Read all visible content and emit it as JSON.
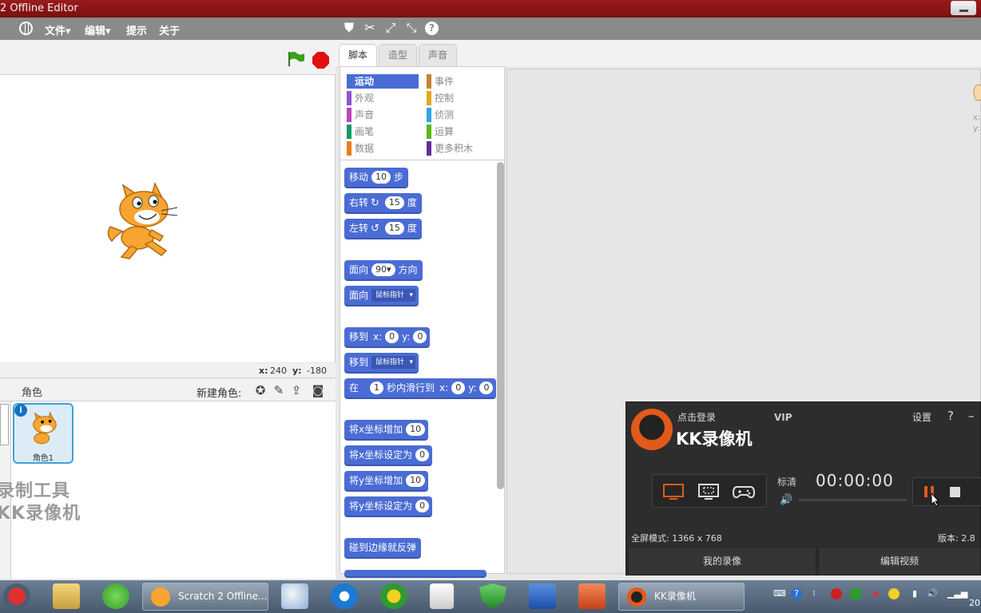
{
  "window": {
    "title": "2 Offline Editor"
  },
  "menu": {
    "file": "文件▾",
    "edit": "编辑▾",
    "tips": "提示",
    "about": "关于",
    "help_icon": "?"
  },
  "stage": {
    "x_label": "x:",
    "x_value": "240",
    "y_label": "y:",
    "y_value": "-180"
  },
  "sprites": {
    "header": "角色",
    "new_sprite": "新建角色:",
    "items": [
      {
        "name": "角色1"
      }
    ],
    "info_glyph": "i"
  },
  "watermark": {
    "line1": "录制工具",
    "line2": "KK录像机"
  },
  "tabs": [
    "脚本",
    "造型",
    "声音"
  ],
  "categories": [
    {
      "label": "运动",
      "color": "#4a6cd4",
      "selected": true
    },
    {
      "label": "外观",
      "color": "#8a55d7"
    },
    {
      "label": "声音",
      "color": "#bb42c3"
    },
    {
      "label": "画笔",
      "color": "#0e9a6c"
    },
    {
      "label": "数据",
      "color": "#ee7d16"
    },
    {
      "label": "事件",
      "color": "#c88330"
    },
    {
      "label": "控制",
      "color": "#e1a91a"
    },
    {
      "label": "侦测",
      "color": "#2ca5e2"
    },
    {
      "label": "运算",
      "color": "#5cb712"
    },
    {
      "label": "更多积木",
      "color": "#632d99"
    }
  ],
  "blocks": {
    "move": {
      "a": "移动",
      "n": "10",
      "b": "步"
    },
    "turn_right": {
      "a": "右转",
      "n": "15",
      "b": "度"
    },
    "turn_left": {
      "a": "左转",
      "n": "15",
      "b": "度"
    },
    "point_dir": {
      "a": "面向",
      "n": "90▾",
      "b": "方向"
    },
    "point_towards": {
      "a": "面向",
      "dd": "鼠标指针"
    },
    "goto_xy": {
      "a": "移到",
      "x": "x:",
      "xn": "0",
      "y": "y:",
      "yn": "0"
    },
    "goto": {
      "a": "移到",
      "dd": "鼠标指针"
    },
    "glide": {
      "a": "在",
      "n": "1",
      "b": "秒内滑行到",
      "x": "x:",
      "xn": "0",
      "y": "y:",
      "yn": "0"
    },
    "change_x": {
      "a": "将x坐标增加",
      "n": "10"
    },
    "set_x": {
      "a": "将x坐标设定为",
      "n": "0"
    },
    "change_y": {
      "a": "将y坐标增加",
      "n": "10"
    },
    "set_y": {
      "a": "将y坐标设定为",
      "n": "0"
    },
    "bounce": {
      "a": "碰到边缘就反弹"
    }
  },
  "scripts_area": {
    "x_label": "x:",
    "y_label": "y:"
  },
  "recorder": {
    "login": "点击登录",
    "vip": "VIP",
    "brand": "KK录像机",
    "settings": "设置",
    "help": "?",
    "close": "–",
    "quality": "标清",
    "timer": "00:00:00",
    "fullscreen_mode": "全屏模式: 1366 x 768",
    "version": "版本: 2.8",
    "my_videos": "我的录像",
    "edit_video": "编辑视频"
  },
  "taskbar": {
    "tasks": [
      {
        "label": "Scratch 2 Offline..."
      },
      {
        "label": "KK录像机"
      }
    ],
    "clock": "20"
  }
}
